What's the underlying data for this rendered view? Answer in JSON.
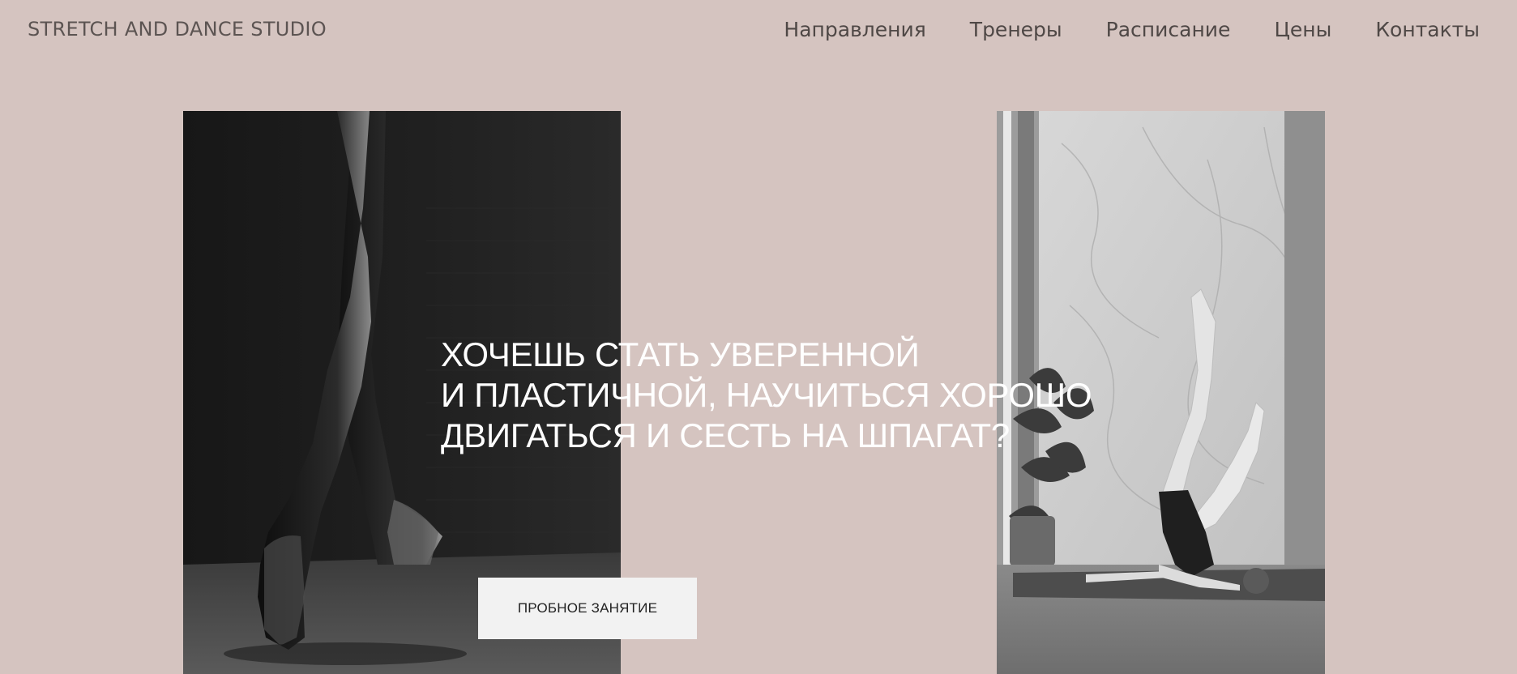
{
  "header": {
    "brand": "STRETCH AND DANCE STUDIO",
    "nav": [
      {
        "label": "Направления"
      },
      {
        "label": "Тренеры"
      },
      {
        "label": "Расписание"
      },
      {
        "label": "Цены"
      },
      {
        "label": "Контакты"
      }
    ]
  },
  "hero": {
    "title_lines": [
      "ХОЧЕШЬ СТАТЬ УВЕРЕННОЙ",
      "И ПЛАСТИЧНОЙ, НАУЧИТЬСЯ ХОРОШО",
      "ДВИГАТЬСЯ И СЕСТЬ НА ШПАГАТ?"
    ],
    "cta_label": "ПРОБНОЕ ЗАНЯТИЕ"
  },
  "colors": {
    "background": "#d5c4c0",
    "header_text": "#5c5452",
    "hero_text": "#ffffff",
    "button_bg": "#f2f2f2"
  }
}
